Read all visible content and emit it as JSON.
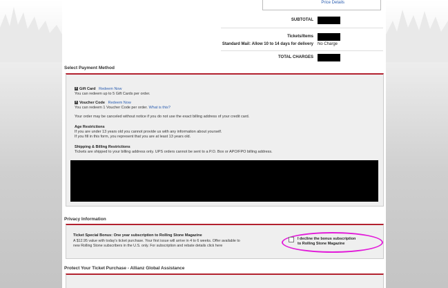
{
  "summary": {
    "price_details": "Price Details",
    "subtotal_label": "SUBTOTAL",
    "tickets_label": "Tickets/Items",
    "shipping_label": "Standard Mail: Allow 10 to 14 days for delivery",
    "shipping_value": "No Charge",
    "total_label": "TOTAL CHARGES"
  },
  "payment": {
    "header": "Select Payment Method",
    "gift_card_title": "Gift Card",
    "gift_card_link": "Redeem Now",
    "gift_card_desc": "You can redeem up to 5 Gift Cards per order.",
    "voucher_title": "Voucher Code",
    "voucher_link": "Redeem Now",
    "voucher_desc": "You can redeem 1 Voucher Code per order.",
    "voucher_whats_this": "What is this?",
    "warning": "Your order may be canceled without notice if you do not use the exact billing address of your credit card.",
    "age_title": "Age Restrictions",
    "age_line1": "If you are under 13 years old you cannot provide us with any information about yourself.",
    "age_line2": "If you fill in this form, you represent that you are at least 13 years old.",
    "shipping_title": "Shipping & Billing Restrictions",
    "shipping_desc": "Tickets are shipped to your billing address only. UPS orders cannot be sent to a P.O. Box or APO/FPO billing address."
  },
  "privacy": {
    "header": "Privacy Information",
    "bonus_title": "Ticket Special Bonus: One year subscription to Rolling Stone Magazine",
    "bonus_desc_line1": "A $12.95 value with today's ticket purchase. Your first issue will arrive in 4 to 6 weeks. Offer available to",
    "bonus_desc_line2": "new Rolling Stone subscribers in the U.S. only. For subscription and rebate details",
    "bonus_link": "click here",
    "decline_line1": "I decline the bonus subscription",
    "decline_line2": "to Rolling Stone Magazine"
  },
  "protect": {
    "header": "Protect Your Ticket Purchase - Allianz Global Assistance"
  },
  "colors": {
    "accent_red": "#b2202e",
    "link_blue": "#2a5db0",
    "highlight_magenta": "#e21ad9"
  }
}
